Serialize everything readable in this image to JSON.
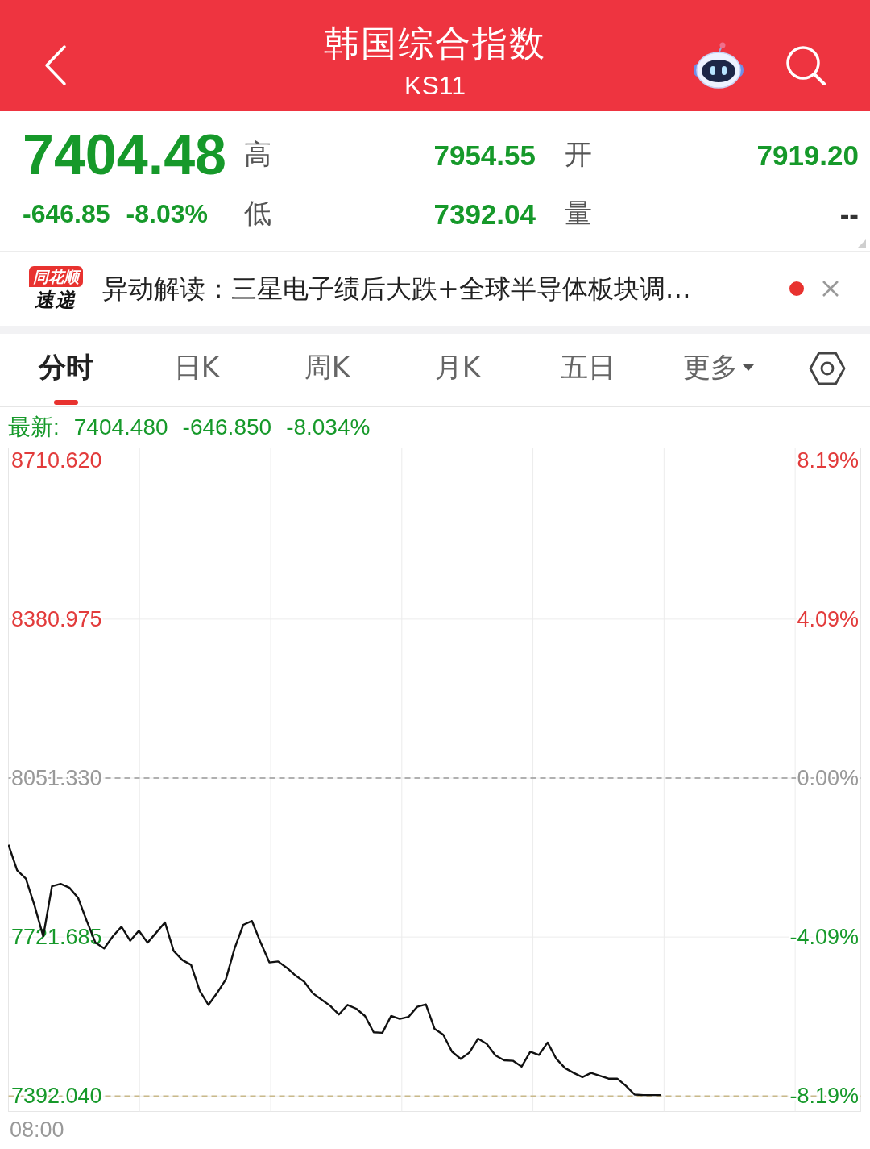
{
  "header": {
    "title": "韩国综合指数",
    "code": "KS11"
  },
  "quote": {
    "price": "7404.48",
    "change": "-646.85",
    "change_pct": "-8.03%",
    "stats": [
      {
        "label": "高",
        "value": "7954.55",
        "color": "#16992a"
      },
      {
        "label": "开",
        "value": "7919.20",
        "color": "#16992a"
      },
      {
        "label": "低",
        "value": "7392.04",
        "color": "#16992a"
      },
      {
        "label": "量",
        "value": "--",
        "color": "#333333"
      }
    ]
  },
  "news": {
    "brand": "同花顺",
    "brand_sub": "速递",
    "text": "异动解读：三星电子绩后大跌+全球半导体板块调…",
    "unread": true
  },
  "tabs": [
    {
      "label": "分时",
      "selected": true,
      "kind": "plain"
    },
    {
      "label": "日K",
      "selected": false,
      "kind": "plain"
    },
    {
      "label": "周K",
      "selected": false,
      "kind": "plain"
    },
    {
      "label": "月K",
      "selected": false,
      "kind": "plain"
    },
    {
      "label": "五日",
      "selected": false,
      "kind": "plain"
    },
    {
      "label": "更多",
      "selected": false,
      "kind": "dropdown"
    }
  ],
  "chart": {
    "latest": {
      "label": "最新:",
      "values": [
        "7404.480",
        "-646.850",
        "-8.034%"
      ]
    },
    "right_axis": [
      {
        "label": "8.19%",
        "color": "#e23b3b"
      },
      {
        "label": "4.09%",
        "color": "#e23b3b"
      },
      {
        "label": "0.00%",
        "color": "#999999"
      },
      {
        "label": "-4.09%",
        "color": "#16992a"
      },
      {
        "label": "-8.19%",
        "color": "#16992a"
      }
    ],
    "chart_data": {
      "type": "line",
      "series": [
        {
          "color": "#111111",
          "values": [
            7913,
            7860,
            7843,
            7787,
            7723,
            7827,
            7832,
            7824,
            7803,
            7755,
            7710,
            7698,
            7723,
            7743,
            7714,
            7735,
            7710,
            7731,
            7752,
            7693,
            7674,
            7664,
            7610,
            7581,
            7606,
            7634,
            7698,
            7747,
            7755,
            7710,
            7669,
            7671,
            7658,
            7642,
            7629,
            7605,
            7592,
            7579,
            7561,
            7581,
            7573,
            7558,
            7524,
            7523,
            7558,
            7552,
            7556,
            7577,
            7582,
            7531,
            7519,
            7484,
            7469,
            7482,
            7511,
            7500,
            7476,
            7466,
            7465,
            7453,
            7484,
            7477,
            7503,
            7469,
            7450,
            7440,
            7431,
            7440,
            7434,
            7428,
            7428,
            7413,
            7395,
            7394,
            7394,
            7394,
            null,
            null,
            null,
            null,
            null,
            null,
            null,
            null,
            null,
            null,
            null,
            null,
            null,
            null,
            null,
            null,
            null,
            null,
            null,
            null,
            null,
            null,
            null
          ]
        }
      ],
      "ylim": [
        7359,
        8737
      ],
      "yticks": [
        {
          "value": 8710.62,
          "label": "8710.620"
        },
        {
          "value": 8380.975,
          "label": "8380.975"
        },
        {
          "value": 8051.33,
          "label": "8051.330"
        },
        {
          "value": 7721.685,
          "label": "7721.685"
        },
        {
          "value": 7392.04,
          "label": "7392.040"
        }
      ],
      "grid": true,
      "ref_lines": [
        {
          "axis": "y",
          "value": 8051.33,
          "color": "#999999"
        },
        {
          "axis": "y",
          "value": 7392.04,
          "color": "#c9b98a"
        }
      ],
      "annotations": [
        "08:00"
      ]
    }
  }
}
